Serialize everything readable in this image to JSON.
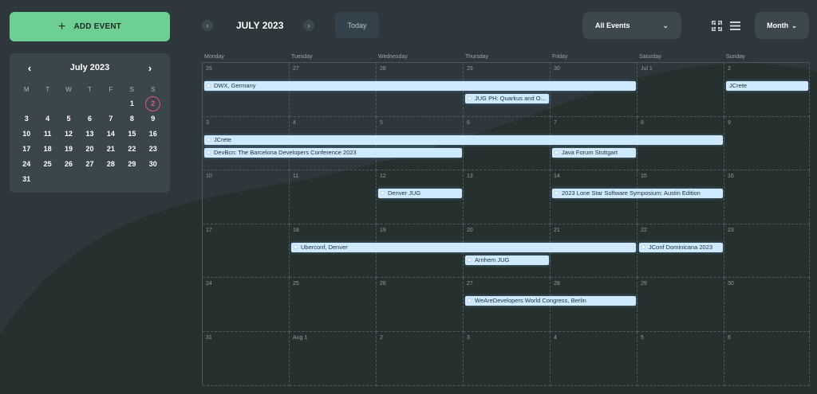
{
  "sidebar": {
    "add_event_label": "ADD EVENT",
    "mini_calendar": {
      "title": "July 2023",
      "weekdays": [
        "M",
        "T",
        "W",
        "T",
        "F",
        "S",
        "S"
      ],
      "today": "2",
      "rows": [
        [
          "",
          "",
          "",
          "",
          "",
          "1",
          "2"
        ],
        [
          "3",
          "4",
          "5",
          "6",
          "7",
          "8",
          "9"
        ],
        [
          "10",
          "11",
          "12",
          "13",
          "14",
          "15",
          "16"
        ],
        [
          "17",
          "18",
          "19",
          "20",
          "21",
          "22",
          "23"
        ],
        [
          "24",
          "25",
          "26",
          "27",
          "28",
          "29",
          "30"
        ],
        [
          "31",
          "",
          "",
          "",
          "",
          "",
          ""
        ]
      ]
    }
  },
  "toolbar": {
    "prev": "‹",
    "next": "›",
    "month_title": "JULY 2023",
    "today_label": "Today",
    "filter_label": "All Events",
    "view_label": "Month"
  },
  "calendar": {
    "weekdays": [
      "Monday",
      "Tuesday",
      "Wednesday",
      "Thursday",
      "Friday",
      "Saturday",
      "Sunday"
    ],
    "weeks": [
      [
        "26",
        "27",
        "28",
        "29",
        "30",
        "Jul 1",
        "2"
      ],
      [
        "3",
        "4",
        "5",
        "6",
        "7",
        "8",
        "9"
      ],
      [
        "10",
        "11",
        "12",
        "13",
        "14",
        "15",
        "16"
      ],
      [
        "17",
        "18",
        "19",
        "20",
        "21",
        "22",
        "23"
      ],
      [
        "24",
        "25",
        "26",
        "27",
        "28",
        "29",
        "30"
      ],
      [
        "31",
        "Aug 1",
        "2",
        "3",
        "4",
        "5",
        "6"
      ]
    ],
    "events": [
      {
        "title": "DWX, Germany",
        "week": 0,
        "start": 0,
        "span": 5,
        "lane": 0,
        "dot": true
      },
      {
        "title": "JCrete",
        "week": 0,
        "start": 6,
        "span": 1,
        "lane": 0,
        "dot": false
      },
      {
        "title": "JUG PH: Quarkus and O...",
        "week": 0,
        "start": 3,
        "span": 1,
        "lane": 1,
        "dot": true
      },
      {
        "title": "JCrete",
        "week": 1,
        "start": 0,
        "span": 6,
        "lane": 0,
        "dot": true
      },
      {
        "title": "DevBcn: The Barcelona Developers Conference 2023",
        "week": 1,
        "start": 0,
        "span": 3,
        "lane": 1,
        "dot": true
      },
      {
        "title": "Java Forum Stuttgart",
        "week": 1,
        "start": 4,
        "span": 1,
        "lane": 1,
        "dot": true
      },
      {
        "title": "Denver JUG",
        "week": 2,
        "start": 2,
        "span": 1,
        "lane": 0,
        "dot": true
      },
      {
        "title": "2023 Lone Star Software Symposium: Austin Edition",
        "week": 2,
        "start": 4,
        "span": 2,
        "lane": 0,
        "dot": true
      },
      {
        "title": "Uberconf, Denver",
        "week": 3,
        "start": 1,
        "span": 4,
        "lane": 0,
        "dot": true
      },
      {
        "title": "JConf Dominicana 2023",
        "week": 3,
        "start": 5,
        "span": 1,
        "lane": 0,
        "dot": true
      },
      {
        "title": "Arnhem JUG",
        "week": 3,
        "start": 3,
        "span": 1,
        "lane": 1,
        "dot": true
      },
      {
        "title": "WeAreDevelopers World Congress, Berlin",
        "week": 4,
        "start": 3,
        "span": 2,
        "lane": 0,
        "dot": true
      }
    ]
  },
  "colors": {
    "background": "#2b353b",
    "accent_green": "#6ecf94",
    "event_fill": "#cfeaff",
    "today_ring": "#e0577a"
  }
}
